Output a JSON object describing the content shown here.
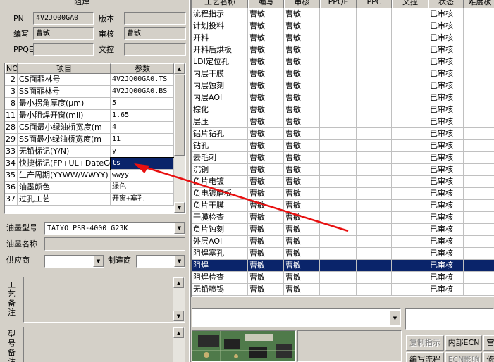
{
  "left_panel": {
    "title": "阻焊",
    "pn_label": "PN",
    "pn_value": "4V2JQ00GA0",
    "version_label": "版本",
    "version_value": "",
    "author_label": "编写",
    "author_value": "曹敏",
    "reviewer_label": "审核",
    "reviewer_value": "曹敏",
    "ppqe_label": "PPQE",
    "ppqe_value": "",
    "doc_control_label": "文控",
    "doc_control_value": ""
  },
  "params_table": {
    "headers": [
      "NO",
      "项目",
      "参数"
    ],
    "rows": [
      {
        "no": "2",
        "item": "CS面菲林号",
        "value": "4V2JQ00GA0.TS"
      },
      {
        "no": "3",
        "item": "SS面菲林号",
        "value": "4V2JQ00GA0.BS"
      },
      {
        "no": "8",
        "item": "最小拐角厚度(μm)",
        "value": "5"
      },
      {
        "no": "11",
        "item": "最小阻焊开窗(mil)",
        "value": "1.65"
      },
      {
        "no": "28",
        "item": "CS面最小绿油桥宽度(m",
        "value": "4"
      },
      {
        "no": "29",
        "item": "SS面最小绿油桥宽度(m",
        "value": "11"
      },
      {
        "no": "33",
        "item": "无铅标记(Y/N)",
        "value": "y"
      },
      {
        "no": "34",
        "item": "快捷标记(FP+UL+DateCo",
        "value": "ts"
      },
      {
        "no": "35",
        "item": "生产周期(YYWW/WWYY)",
        "value": "wwyy"
      },
      {
        "no": "36",
        "item": "油墨颜色",
        "value": "绿色"
      },
      {
        "no": "37",
        "item": "过孔工艺",
        "value": "开窗+塞孔"
      }
    ],
    "editing_row": 7
  },
  "ink": {
    "type_label": "油墨型号",
    "type_value": "TAIYO PSR-4000 G23K",
    "name_label": "油墨名称",
    "name_value": "",
    "supplier_label": "供应商",
    "supplier_value": "",
    "maker_label": "制造商",
    "maker_value": ""
  },
  "notes": {
    "process_note_label": "工艺备注",
    "model_note_label": "型号备注"
  },
  "process_table": {
    "headers": [
      "工艺名称",
      "编写",
      "审核",
      "PPQE",
      "PPC",
      "文控",
      "状态",
      "难度板"
    ],
    "rows": [
      {
        "name": "流程指示",
        "author": "曹敏",
        "reviewer": "曹敏",
        "status": "已审核"
      },
      {
        "name": "计划投料",
        "author": "曹敏",
        "reviewer": "曹敏",
        "status": "已审核"
      },
      {
        "name": "开料",
        "author": "曹敏",
        "reviewer": "曹敏",
        "status": "已审核"
      },
      {
        "name": "开料后烘板",
        "author": "曹敏",
        "reviewer": "曹敏",
        "status": "已审核"
      },
      {
        "name": "LDI定位孔",
        "author": "曹敏",
        "reviewer": "曹敏",
        "status": "已审核"
      },
      {
        "name": "内层干膜",
        "author": "曹敏",
        "reviewer": "曹敏",
        "status": "已审核"
      },
      {
        "name": "内层蚀刻",
        "author": "曹敏",
        "reviewer": "曹敏",
        "status": "已审核"
      },
      {
        "name": "内层AOI",
        "author": "曹敏",
        "reviewer": "曹敏",
        "status": "已审核"
      },
      {
        "name": "棕化",
        "author": "曹敏",
        "reviewer": "曹敏",
        "status": "已审核"
      },
      {
        "name": "层压",
        "author": "曹敏",
        "reviewer": "曹敏",
        "status": "已审核"
      },
      {
        "name": "铝片钻孔",
        "author": "曹敏",
        "reviewer": "曹敏",
        "status": "已审核"
      },
      {
        "name": "钻孔",
        "author": "曹敏",
        "reviewer": "曹敏",
        "status": "已审核"
      },
      {
        "name": "去毛刺",
        "author": "曹敏",
        "reviewer": "曹敏",
        "status": "已审核"
      },
      {
        "name": "沉铜",
        "author": "曹敏",
        "reviewer": "曹敏",
        "status": "已审核"
      },
      {
        "name": "负片电镀",
        "author": "曹敏",
        "reviewer": "曹敏",
        "status": "已审核"
      },
      {
        "name": "负电镀磨板",
        "author": "曹敏",
        "reviewer": "曹敏",
        "status": "已审核"
      },
      {
        "name": "负片干膜",
        "author": "曹敏",
        "reviewer": "曹敏",
        "status": "已审核"
      },
      {
        "name": "干膜检查",
        "author": "曹敏",
        "reviewer": "曹敏",
        "status": "已审核"
      },
      {
        "name": "负片蚀刻",
        "author": "曹敏",
        "reviewer": "曹敏",
        "status": "已审核"
      },
      {
        "name": "外层AOI",
        "author": "曹敏",
        "reviewer": "曹敏",
        "status": "已审核"
      },
      {
        "name": "阻焊塞孔",
        "author": "曹敏",
        "reviewer": "曹敏",
        "status": "已审核"
      },
      {
        "name": "阻焊",
        "author": "曹敏",
        "reviewer": "曹敏",
        "status": "已审核"
      },
      {
        "name": "阻焊检查",
        "author": "曹敏",
        "reviewer": "曹敏",
        "status": "已审核"
      },
      {
        "name": "无铅喷锡",
        "author": "曹敏",
        "reviewer": "曹敏",
        "status": "已审核"
      }
    ],
    "selected_row": 21
  },
  "buttons": {
    "copy_instruction": "复制指示",
    "internal_ecn": "内部ECN",
    "edit_process": "编写流程",
    "ecn_impact": "ECN影响",
    "cut_3": "宫",
    "cut_4": "修"
  },
  "colors": {
    "face": "#d4d0c8",
    "selection": "#0a246a",
    "annotation_arrow": "#e81010"
  }
}
